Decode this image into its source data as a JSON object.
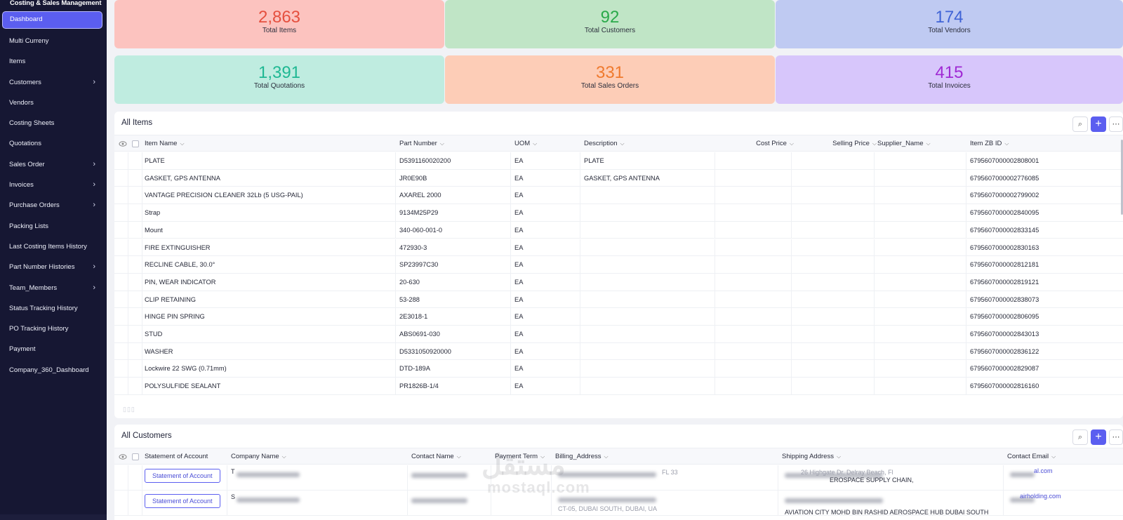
{
  "app": {
    "title": "Costing & Sales Management"
  },
  "sidebar": {
    "items": [
      {
        "label": "Dashboard",
        "active": true,
        "chevron": false
      },
      {
        "label": "Multi Curreny",
        "chevron": false
      },
      {
        "label": "Items",
        "chevron": false
      },
      {
        "label": "Customers",
        "chevron": true
      },
      {
        "label": "Vendors",
        "chevron": false
      },
      {
        "label": "Costing Sheets",
        "chevron": false
      },
      {
        "label": "Quotations",
        "chevron": false
      },
      {
        "label": "Sales Order",
        "chevron": true
      },
      {
        "label": "Invoices",
        "chevron": true
      },
      {
        "label": "Purchase Orders",
        "chevron": true
      },
      {
        "label": "Packing Lists",
        "chevron": false
      },
      {
        "label": "Last Costing Items History",
        "chevron": false
      },
      {
        "label": "Part Number Histories",
        "chevron": true
      },
      {
        "label": "Team_Members",
        "chevron": true
      },
      {
        "label": "Status Tracking History",
        "chevron": false
      },
      {
        "label": "PO Tracking History",
        "chevron": false
      },
      {
        "label": "Payment",
        "chevron": false
      },
      {
        "label": "Company_360_Dashboard",
        "chevron": false
      }
    ],
    "chevron_glyph": "›"
  },
  "cards": [
    {
      "value": "2,863",
      "label": "Total Items",
      "bg": "#fcc3bf",
      "fg": "#e5503f"
    },
    {
      "value": "92",
      "label": "Total Customers",
      "bg": "#c0e5c6",
      "fg": "#2aa94a"
    },
    {
      "value": "174",
      "label": "Total Vendors",
      "bg": "#bfcaf2",
      "fg": "#3f63d6"
    },
    {
      "value": "1,391",
      "label": "Total Quotations",
      "bg": "#bfece0",
      "fg": "#1fb893"
    },
    {
      "value": "331",
      "label": "Total Sales Orders",
      "bg": "#fdcdb7",
      "fg": "#ef7a2e"
    },
    {
      "value": "415",
      "label": "Total Invoices",
      "bg": "#d7c6fb",
      "fg": "#a02ad4"
    }
  ],
  "items_panel": {
    "title": "All Items",
    "tools": {
      "search_glyph": "⌕",
      "add_glyph": "+",
      "more_glyph": "⋯"
    },
    "sort_glyph": "⌵",
    "columns": [
      "Item Name",
      "Part Number",
      "UOM",
      "Description",
      "Cost Price",
      "Selling Price",
      "Supplier_Name",
      "Item ZB ID"
    ],
    "rows": [
      [
        "PLATE",
        "D5391160020200",
        "EA",
        "PLATE",
        "",
        "",
        "",
        "6795607000002808001"
      ],
      [
        "GASKET, GPS ANTENNA",
        "JR0E90B",
        "EA",
        "GASKET, GPS ANTENNA",
        "",
        "",
        "",
        "6795607000002776085"
      ],
      [
        "VANTAGE PRECISION CLEANER 32Lb (5 USG-PAIL)",
        "AXAREL 2000",
        "EA",
        "",
        "",
        "",
        "",
        "6795607000002799002"
      ],
      [
        "Strap",
        "9134M25P29",
        "EA",
        "",
        "",
        "",
        "",
        "6795607000002840095"
      ],
      [
        "Mount",
        "340-060-001-0",
        "EA",
        "",
        "",
        "",
        "",
        "6795607000002833145"
      ],
      [
        "FIRE EXTINGUISHER",
        "472930-3",
        "EA",
        "",
        "",
        "",
        "",
        "6795607000002830163"
      ],
      [
        "RECLINE CABLE, 30.0°",
        "SP23997C30",
        "EA",
        "",
        "",
        "",
        "",
        "6795607000002812181"
      ],
      [
        "PIN, WEAR INDICATOR",
        "20-630",
        "EA",
        "",
        "",
        "",
        "",
        "6795607000002819121"
      ],
      [
        "CLIP RETAINING",
        "53-288",
        "EA",
        "",
        "",
        "",
        "",
        "6795607000002838073"
      ],
      [
        "HINGE PIN SPRING",
        "2E3018-1",
        "EA",
        "",
        "",
        "",
        "",
        "6795607000002806095"
      ],
      [
        "STUD",
        "ABS0691-030",
        "EA",
        "",
        "",
        "",
        "",
        "6795607000002843013"
      ],
      [
        "WASHER",
        "D5331050920000",
        "EA",
        "",
        "",
        "",
        "",
        "6795607000002836122"
      ],
      [
        "Lockwire 22 SWG (0.71mm)",
        "DTD-189A",
        "EA",
        "",
        "",
        "",
        "",
        "6795607000002829087"
      ],
      [
        "POLYSULFIDE SEALANT",
        "PR1826B-1/4",
        "EA",
        "",
        "",
        "",
        "",
        "6795607000002816160"
      ]
    ],
    "pager": "▯▯▯"
  },
  "customers_panel": {
    "title": "All Customers",
    "columns": [
      "Statement of Account",
      "Company Name",
      "Contact Name",
      "Payment Term",
      "Billing_Address",
      "Shipping Address",
      "Contact Email"
    ],
    "rows": [
      {
        "button": "Statement of Account",
        "company": "T",
        "billing": "FL 33",
        "shipping": "26 Highgate Dr. Delray Beach, Fl",
        "shipping2": "EROSPACE SUPPLY CHAIN,",
        "email": "al.com"
      },
      {
        "button": "Statement of Account",
        "company": "S",
        "billing": "CT-05, DUBAI SOUTH, DUBAI, UA",
        "shipping": "AVIATION CITY MOHD BIN RASHID AEROSPACE HUB DUBAI SOUTH",
        "email": "airholding.com"
      }
    ]
  },
  "watermark": {
    "logo": "مستقل",
    "sub": "mostaql.com"
  }
}
